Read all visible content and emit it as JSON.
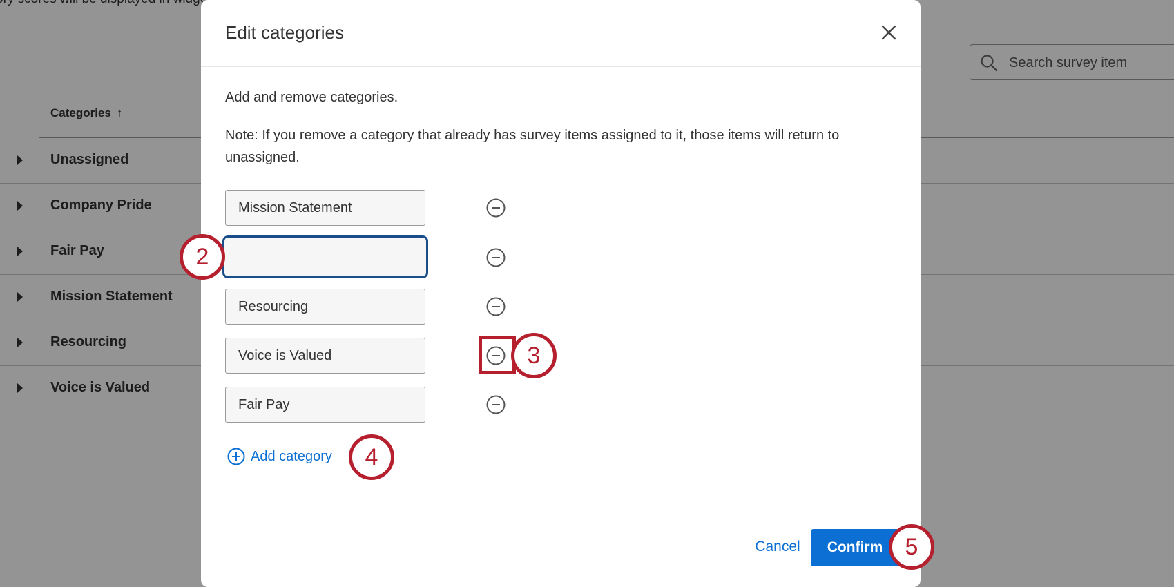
{
  "background": {
    "top_note": "ory scores will be displayed in widgets in this dashboard.",
    "search": {
      "placeholder": "Search survey item"
    },
    "categories_header": "Categories",
    "sort_arrow": "↑",
    "rows": [
      {
        "label": "Unassigned"
      },
      {
        "label": "Company Pride"
      },
      {
        "label": "Fair Pay"
      },
      {
        "label": "Mission Statement"
      },
      {
        "label": "Resourcing"
      },
      {
        "label": "Voice is Valued"
      }
    ]
  },
  "modal": {
    "title": "Edit categories",
    "intro": "Add and remove categories.",
    "note": "Note: If you remove a category that already has survey items assigned to it, those items will return to unassigned.",
    "categories": [
      {
        "value": "Mission Statement"
      },
      {
        "value": ""
      },
      {
        "value": "Resourcing"
      },
      {
        "value": "Voice is Valued"
      },
      {
        "value": "Fair Pay"
      }
    ],
    "add_category_label": "Add category",
    "cancel_label": "Cancel",
    "confirm_label": "Confirm"
  },
  "steps": [
    "2",
    "3",
    "4",
    "5"
  ],
  "icons": {
    "search": "search-icon",
    "close": "close-icon",
    "remove": "minus-circle-icon",
    "add": "plus-circle-icon",
    "caret": "caret-right-icon"
  },
  "colors": {
    "accent": "#0b6fd3",
    "callout": "#b51f2e",
    "focus_border": "#1a4e8a"
  }
}
